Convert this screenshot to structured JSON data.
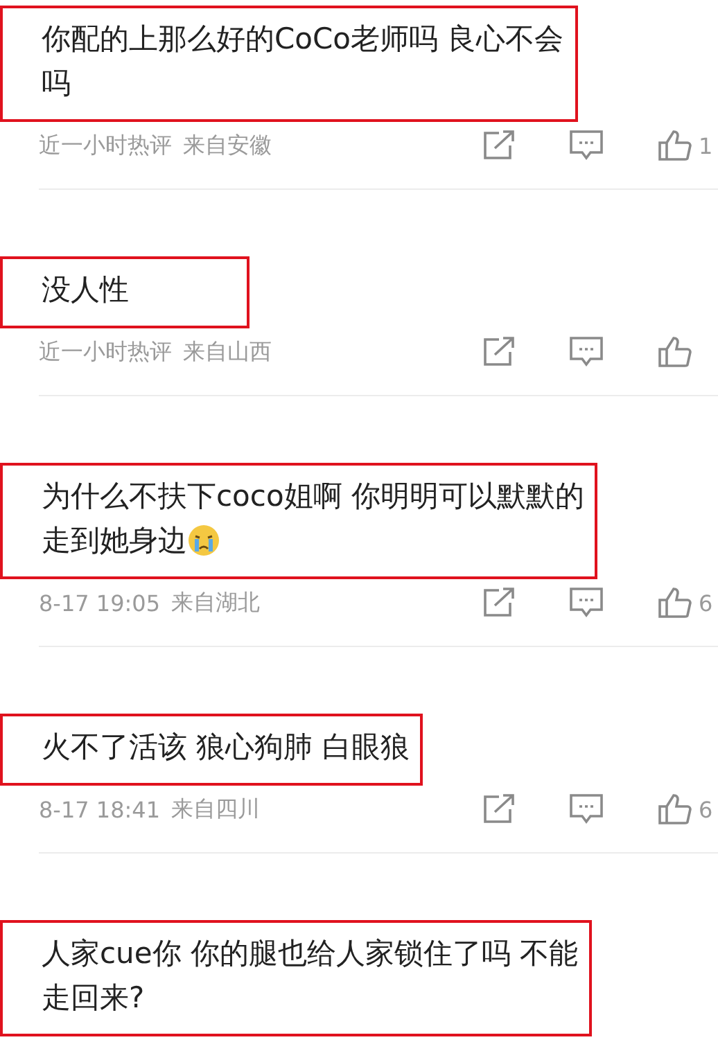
{
  "comments": [
    {
      "lines": [
        "你配的上那么好的CoCo老师吗 良心不会",
        "吗"
      ],
      "emoji": false,
      "highlighted": true,
      "time": "近一小时热评",
      "location": "来自安徽",
      "likes": "1"
    },
    {
      "lines": [
        "没人性"
      ],
      "emoji": false,
      "highlighted": true,
      "time": "近一小时热评",
      "location": "来自山西"
    },
    {
      "lines": [
        "为什么不扶下coco姐啊 你明明可以默默的",
        "走到她身边"
      ],
      "emoji": true,
      "highlighted": true,
      "time": "8-17 19:05",
      "location": "来自湖北",
      "likes": "6"
    },
    {
      "lines": [
        "火不了活该 狼心狗肺 白眼狼"
      ],
      "emoji": false,
      "highlighted": true,
      "time": "8-17 18:41",
      "location": "来自四川",
      "likes": "6"
    },
    {
      "lines": [
        "人家cue你 你的腿也给人家锁住了吗 不能",
        "走回来?"
      ],
      "emoji": false,
      "highlighted": true
    }
  ]
}
